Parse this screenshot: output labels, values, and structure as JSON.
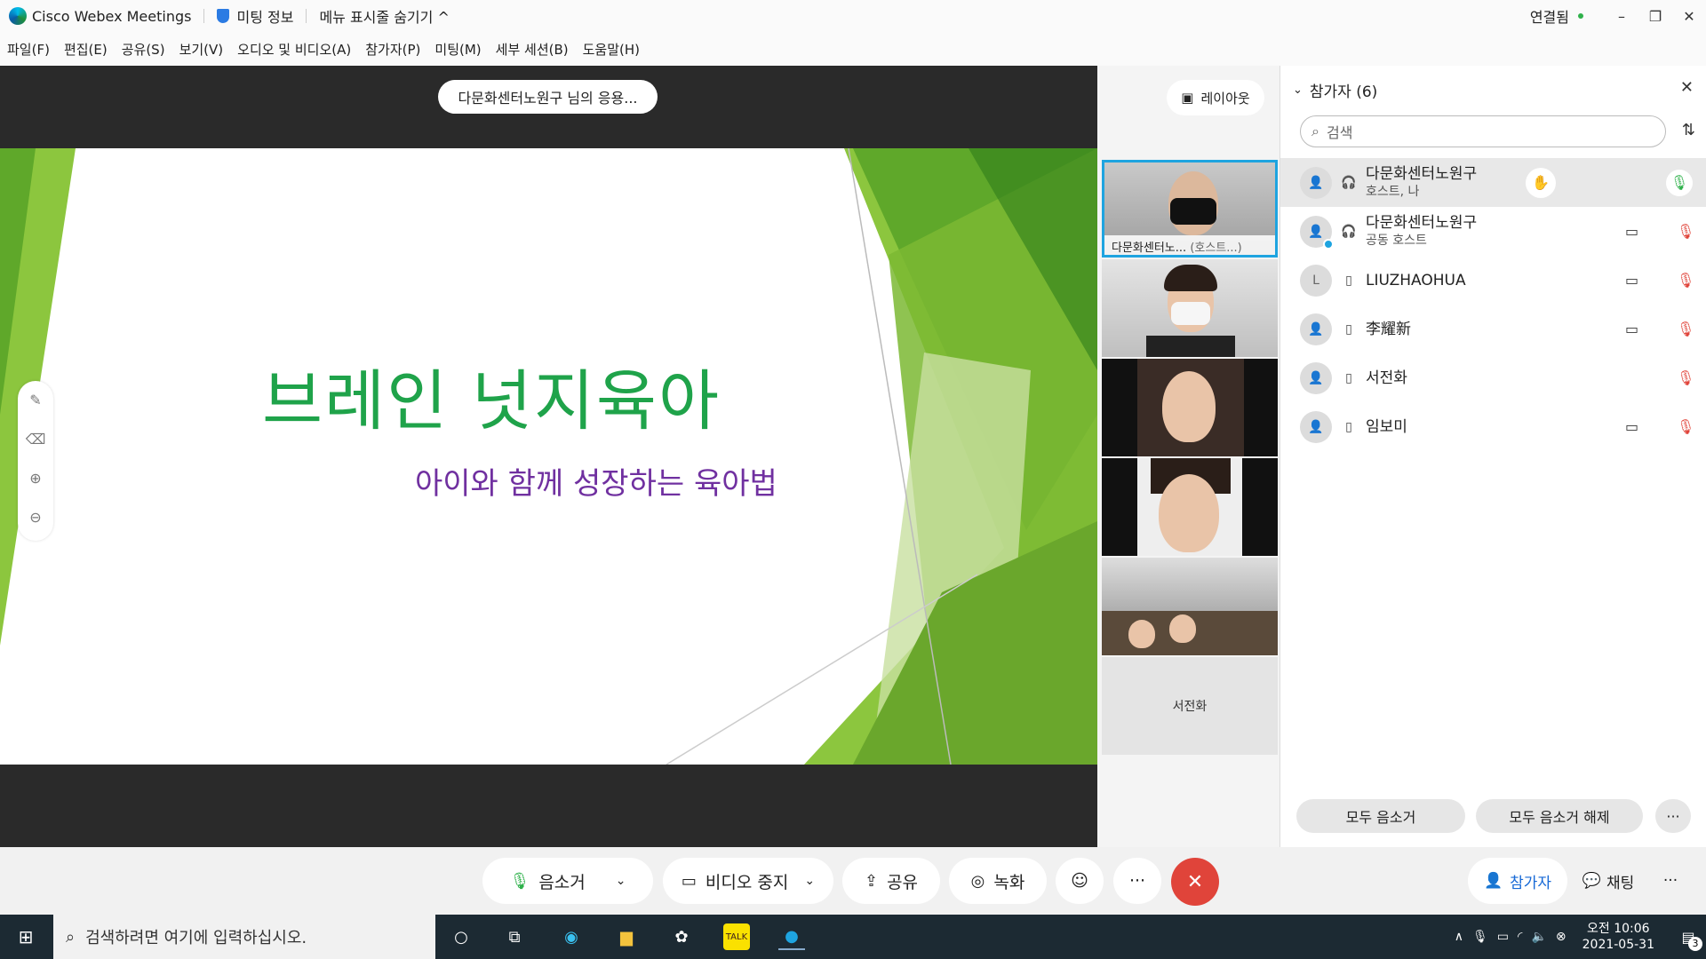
{
  "titlebar": {
    "app_name": "Cisco Webex Meetings",
    "meeting_info": "미팅 정보",
    "menu_toggle": "메뉴 표시줄 숨기기 ^",
    "status": "연결됨"
  },
  "menu": [
    "파일(F)",
    "편집(E)",
    "공유(S)",
    "보기(V)",
    "오디오 및 비디오(A)",
    "참가자(P)",
    "미팅(M)",
    "세부 세션(B)",
    "도움말(H)"
  ],
  "stage": {
    "share_pill": "다문화센터노원구 님의 응용...",
    "layout_button": "레이아웃",
    "slide_title": "브레인 넛지육아",
    "slide_subtitle": "아이와 함께 성장하는 육아법"
  },
  "filmstrip": {
    "tile1_name": "다문화센터노...",
    "tile1_role": "(호스트...)",
    "last_tile_name": "서전화"
  },
  "panel": {
    "title": "참가자 (6)",
    "search_placeholder": "검색",
    "participants": [
      {
        "name": "다문화센터노원구",
        "role": "호스트, 나",
        "avatar": "person-icon"
      },
      {
        "name": "다문화센터노원구",
        "role": "공동 호스트",
        "avatar": "person-icon"
      },
      {
        "name": "LIUZHAOHUA",
        "role": "",
        "avatar": "L"
      },
      {
        "name": "李耀新",
        "role": "",
        "avatar": "person-icon"
      },
      {
        "name": "서전화",
        "role": "",
        "avatar": "person-icon"
      },
      {
        "name": "임보미",
        "role": "",
        "avatar": "person-icon"
      }
    ],
    "mute_all": "모두 음소거",
    "unmute_all": "모두 음소거 해제"
  },
  "controls": {
    "mute": "음소거",
    "stop_video": "비디오 중지",
    "share": "공유",
    "record": "녹화",
    "participants": "참가자",
    "chat": "채팅"
  },
  "taskbar": {
    "search_placeholder": "검색하려면 여기에 입력하십시오.",
    "time": "오전 10:06",
    "date": "2021-05-31",
    "notification_count": "3"
  },
  "colors": {
    "slide_title": "#1fa34a",
    "slide_subtitle": "#7030a0",
    "end_button": "#e0443a",
    "active_tile_border": "#1ea4e0"
  }
}
